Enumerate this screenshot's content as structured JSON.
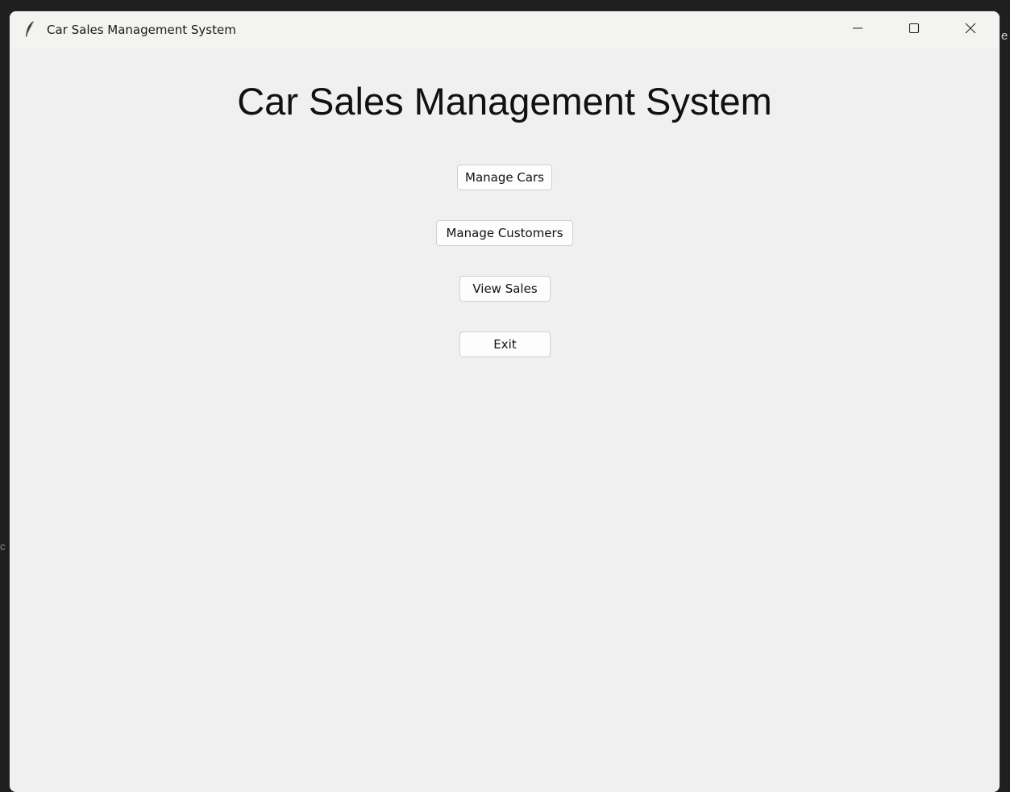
{
  "window": {
    "title": "Car Sales Management System",
    "app_icon": "feather-icon",
    "controls": {
      "minimize_icon": "minimize-icon",
      "maximize_icon": "maximize-icon",
      "close_icon": "close-icon"
    }
  },
  "background": {
    "fragment_right": "e",
    "fragment_left": "c"
  },
  "main": {
    "heading": "Car Sales Management System",
    "buttons": [
      {
        "label": "Manage Cars"
      },
      {
        "label": "Manage Customers"
      },
      {
        "label": "View Sales"
      },
      {
        "label": "Exit"
      }
    ]
  },
  "colors": {
    "window_bg": "#f0f0f0",
    "titlebar_bg": "#f3f3f1",
    "button_bg": "#fdfdfd",
    "button_border": "#d0d0d0",
    "desktop_bg": "#1f1f1f"
  }
}
